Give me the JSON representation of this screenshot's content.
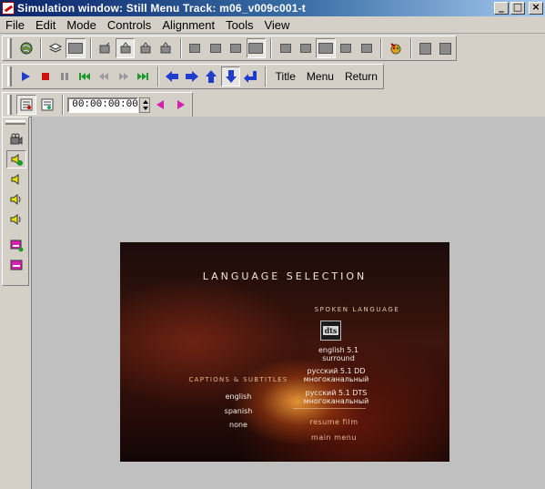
{
  "window": {
    "title": "Simulation window: Still Menu Track: m06_v009c001-t"
  },
  "menu": [
    "File",
    "Edit",
    "Mode",
    "Controls",
    "Alignment",
    "Tools",
    "View"
  ],
  "toolbar2": {
    "title_label": "Title",
    "menu_label": "Menu",
    "return_label": "Return"
  },
  "toolbar3": {
    "timecode": "00:00:00:00"
  },
  "video_menu": {
    "heading": "LANGUAGE SELECTION",
    "spoken_heading": "SPOKEN LANGUAGE",
    "dts_logo": "dts",
    "audio_options": [
      {
        "line1": "english 5.1",
        "line2": "surround"
      },
      {
        "line1": "русский 5.1 DD",
        "line2": "многоканальный"
      },
      {
        "line1": "русский 5.1 DTS",
        "line2": "многоканальный"
      }
    ],
    "captions_heading": "CAPTIONS & SUBTITLES",
    "subtitle_options": [
      "english",
      "spanish",
      "none"
    ],
    "resume_label": "resume film",
    "main_menu_label": "main menu"
  },
  "colors": {
    "titlebar_start": "#0a246a",
    "titlebar_end": "#a6caf0",
    "nav_arrow": "#1f3ccf",
    "stop_red": "#cc1111",
    "magenta": "#d61fb0"
  }
}
